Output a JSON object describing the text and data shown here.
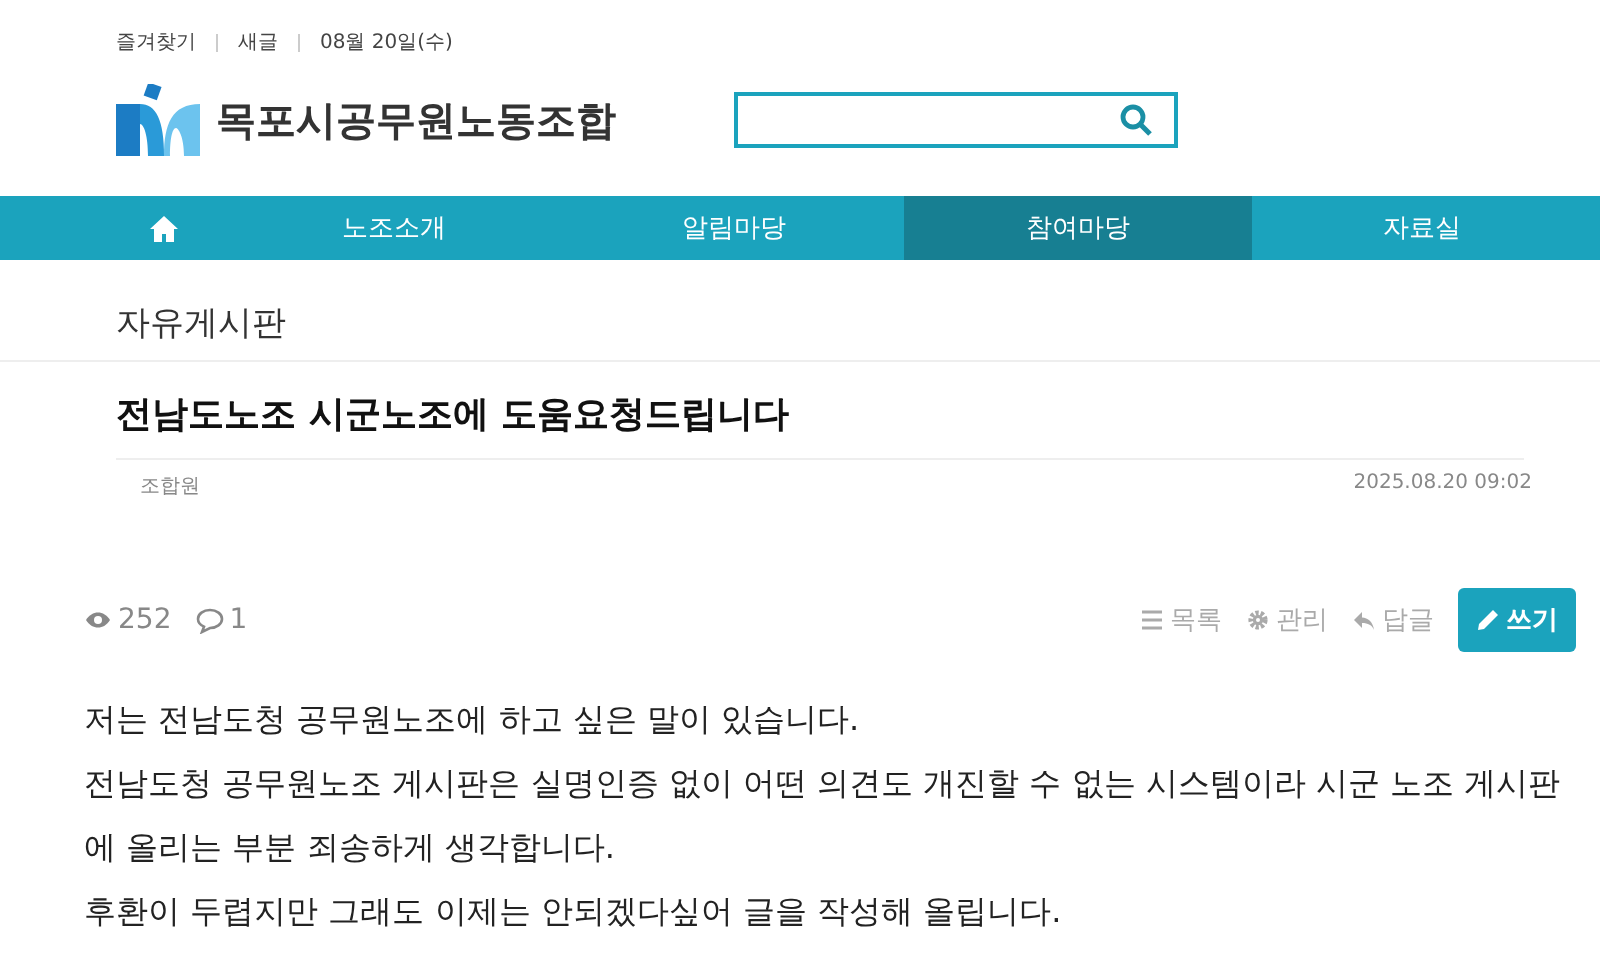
{
  "top_links": [
    "즐겨찾기",
    "새글",
    "08월 20일(수)"
  ],
  "logo": {
    "name": "목포시공무원노동조합"
  },
  "nav": [
    {
      "label": "노조소개",
      "selected": false
    },
    {
      "label": "알림마당",
      "selected": false
    },
    {
      "label": "참여마당",
      "selected": true
    },
    {
      "label": "자료실",
      "selected": false
    }
  ],
  "board_title": "자유게시판",
  "post": {
    "title": "전남도노조 시군노조에 도움요청드립니다",
    "author": "조합원",
    "date": "2025.08.20 09:02",
    "views": "252",
    "comments": "1"
  },
  "actions": [
    {
      "kind": "list",
      "label": "목록"
    },
    {
      "kind": "admin",
      "label": "관리"
    },
    {
      "kind": "reply",
      "label": "답글"
    },
    {
      "kind": "write",
      "label": "쓰기"
    }
  ],
  "body": [
    "저는 전남도청 공무원노조에 하고 싶은 말이 있습니다.",
    "전남도청 공무원노조 게시판은 실명인증 없이 어떤 의견도 개진할 수 없는 시스템이라 시군 노조 게시판에 올리는 부분 죄송하게 생각합니다.",
    "후환이 두렵지만 그래도 이제는 안되겠다싶어 글을 작성해 올립니다."
  ]
}
